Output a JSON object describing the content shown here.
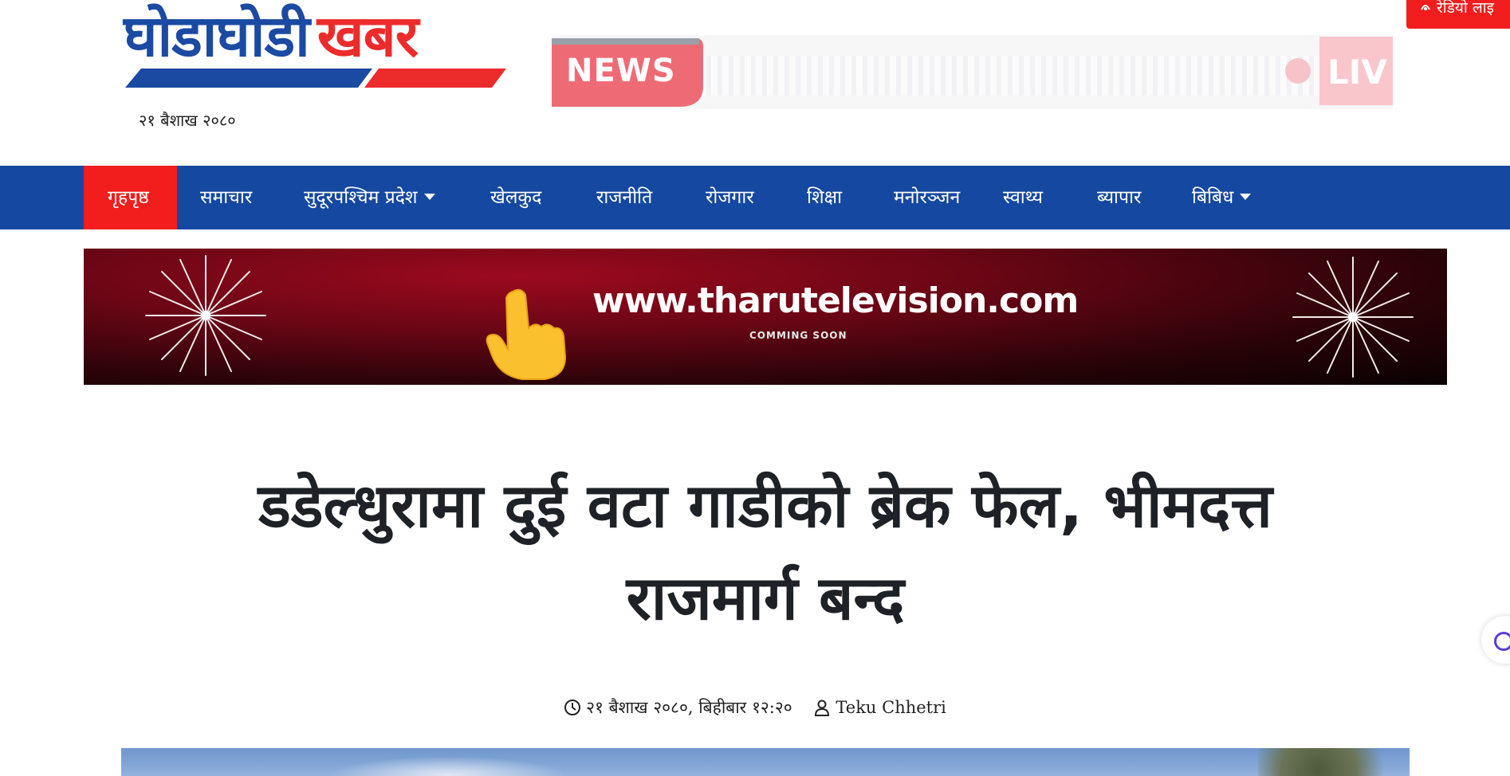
{
  "header": {
    "logo_main": "घोडाघोडी",
    "logo_accent": "खबर",
    "date": "२१ बैशाख २०८०",
    "news_badge": "NEWS",
    "live_label": "LIV",
    "radio_label": "रेडियो लाइ"
  },
  "nav": {
    "items": [
      {
        "label": "गृहपृष्ठ"
      },
      {
        "label": "समाचार"
      },
      {
        "label": "सुदूरपश्चिम प्रदेश"
      },
      {
        "label": "खेलकुद"
      },
      {
        "label": "राजनीति"
      },
      {
        "label": "रोजगार"
      },
      {
        "label": "शिक्षा"
      },
      {
        "label": "मनोरञ्जन"
      },
      {
        "label": "स्वाथ्य"
      },
      {
        "label": "ब्यापार"
      },
      {
        "label": "बिबिध"
      }
    ]
  },
  "ad": {
    "url": "www.tharutelevision.com",
    "subtext": "COMMING SOON"
  },
  "article": {
    "title_line1": "डडेल्धुरामा दुई वटा गाडीको ब्रेक फेल, भीमदत्त",
    "title_line2": "राजमार्ग बन्द",
    "date": "२१ बैशाख २०८०, बिहीबार १२:२०",
    "author": "Teku Chhetri"
  },
  "colors": {
    "brand_blue": "#1548a0",
    "brand_red": "#f21d1d",
    "logo_blue": "#1b4aa3",
    "logo_red": "#ec2b2b"
  }
}
